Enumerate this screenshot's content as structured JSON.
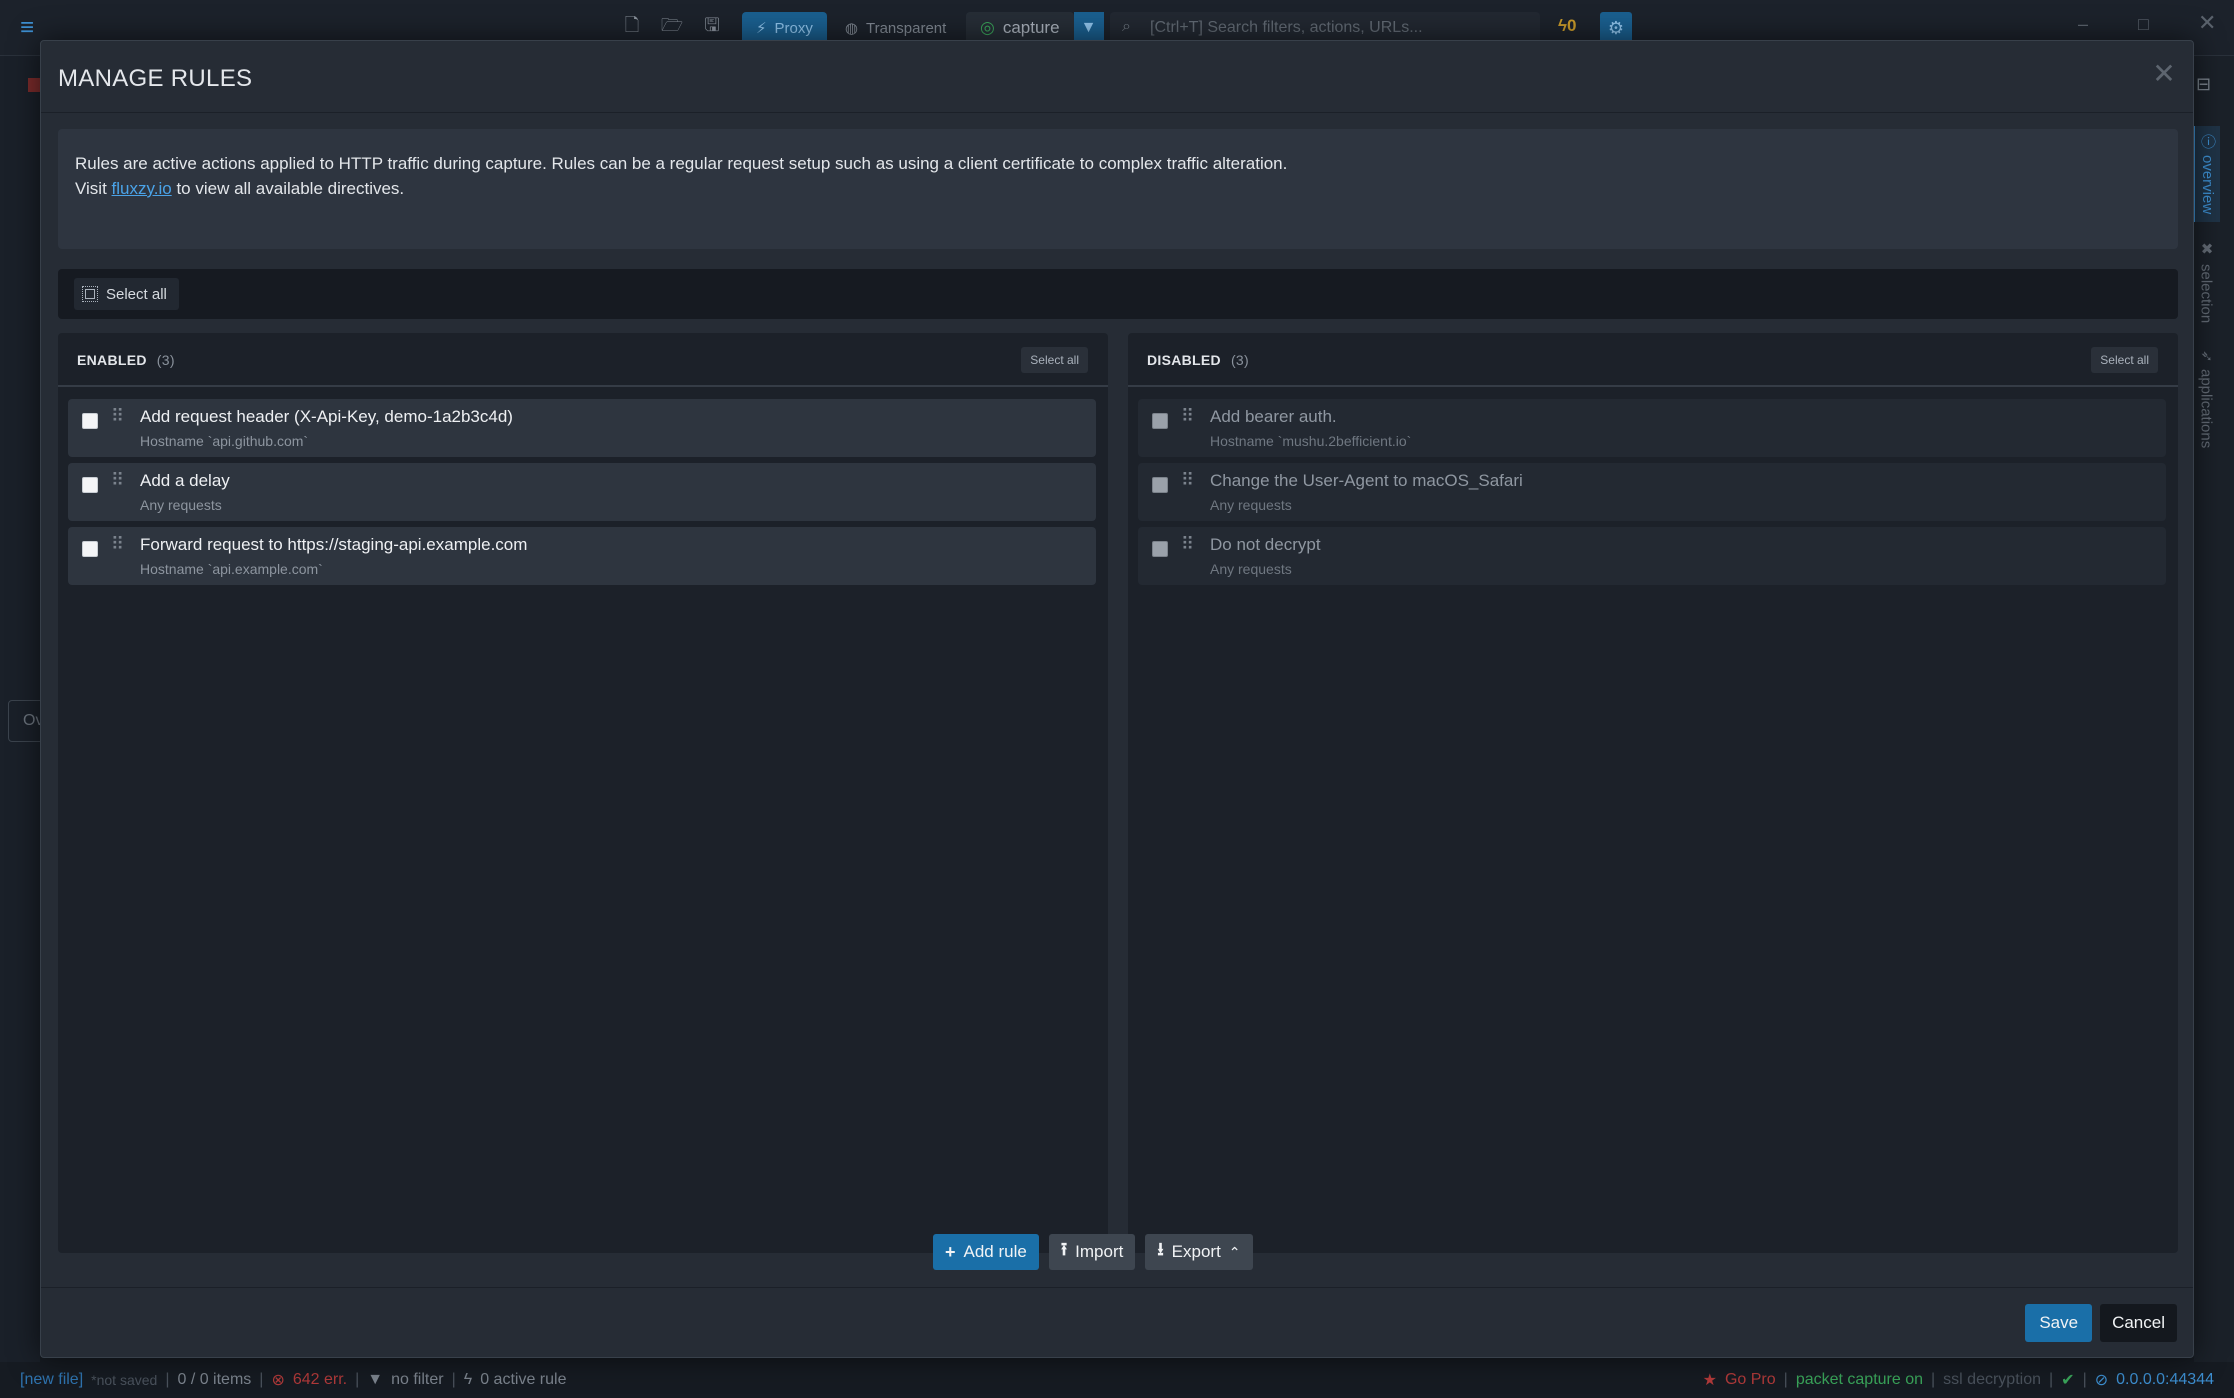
{
  "app": {
    "toolbar": {
      "proxy_label": "Proxy",
      "transparent_label": "Transparent",
      "capture_label": "capture",
      "search_placeholder": "[Ctrl+T] Search filters, actions, URLs...",
      "bolt_count": "0"
    },
    "left_tab_label": "Ov",
    "side_tabs": [
      {
        "label": "overview",
        "icon": "info-icon",
        "active": true
      },
      {
        "label": "selection",
        "icon": "cross-icon",
        "active": false
      },
      {
        "label": "applications",
        "icon": "rocket-icon",
        "active": false
      }
    ],
    "status": {
      "file": "[new file]",
      "not_saved": "*not saved",
      "items": "0 / 0 items",
      "errors": "642 err.",
      "filter": "no filter",
      "active_rules": "0 active rule",
      "go_pro": "Go Pro",
      "packet_capture": "packet capture on",
      "ssl": "ssl decryption",
      "address": "0.0.0.0:44344"
    }
  },
  "modal": {
    "title": "MANAGE RULES",
    "intro_line1": "Rules are active actions applied to HTTP traffic during capture. Rules can be a regular request setup such as using a client certificate to complex traffic alteration.",
    "intro_visit": "Visit",
    "intro_link": "fluxzy.io",
    "intro_line2_rest": "to view all available directives.",
    "select_all_label": "Select all",
    "enabled": {
      "title": "ENABLED",
      "count": "(3)",
      "select_all": "Select all",
      "rules": [
        {
          "name": "Add request header (X-Api-Key, demo-1a2b3c4d)",
          "filter": "Hostname `api.github.com`"
        },
        {
          "name": "Add a delay",
          "filter": "Any requests"
        },
        {
          "name": "Forward request to https://staging-api.example.com",
          "filter": "Hostname `api.example.com`"
        }
      ]
    },
    "disabled": {
      "title": "DISABLED",
      "count": "(3)",
      "select_all": "Select all",
      "rules": [
        {
          "name": "Add bearer auth.",
          "filter": "Hostname `mushu.2befficient.io`"
        },
        {
          "name": "Change the User-Agent to macOS_Safari",
          "filter": "Any requests"
        },
        {
          "name": "Do not decrypt",
          "filter": "Any requests"
        }
      ]
    },
    "actions": {
      "add_rule": "Add rule",
      "import": "Import",
      "export": "Export"
    },
    "footer": {
      "save": "Save",
      "cancel": "Cancel"
    }
  },
  "colors": {
    "accent": "#1a6fa8",
    "link": "#4aa3e8",
    "background": "#161b22",
    "modal": "#262c35"
  }
}
